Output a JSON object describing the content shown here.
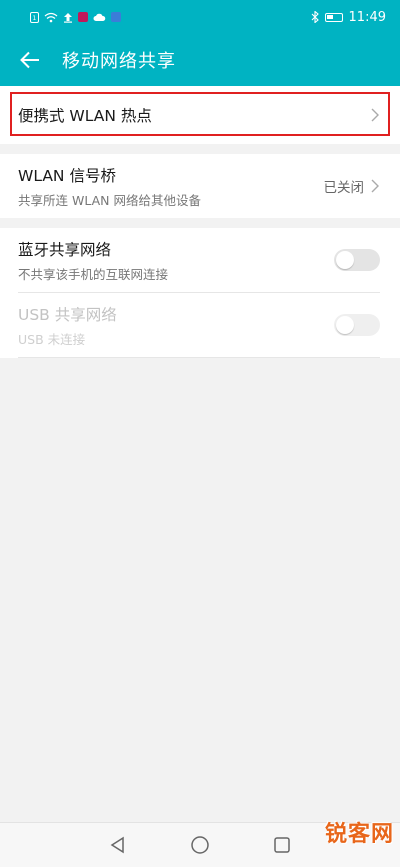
{
  "status_bar": {
    "time": "11:49",
    "left_icons": [
      "sim-icon",
      "wifi-icon",
      "upload-icon",
      "app-icon",
      "cloud-icon",
      "notification-icon"
    ],
    "right_icons": [
      "bluetooth-icon",
      "battery-icon"
    ]
  },
  "header": {
    "title": "移动网络共享",
    "background": "#00b3c2"
  },
  "settings": {
    "hotspot": {
      "label": "便携式 WLAN 热点"
    },
    "wlan_bridge": {
      "label": "WLAN 信号桥",
      "description": "共享所连 WLAN 网络给其他设备",
      "value": "已关闭"
    },
    "bluetooth_tethering": {
      "label": "蓝牙共享网络",
      "description": "不共享该手机的互联网连接",
      "enabled": false
    },
    "usb_tethering": {
      "label": "USB 共享网络",
      "description": "USB 未连接",
      "enabled": false,
      "disabled": true
    }
  },
  "highlight_color": "#e02020",
  "nav_bar": {
    "icons": [
      "back-triangle-icon",
      "home-circle-icon",
      "recent-square-icon"
    ]
  },
  "watermark": "锐客网"
}
